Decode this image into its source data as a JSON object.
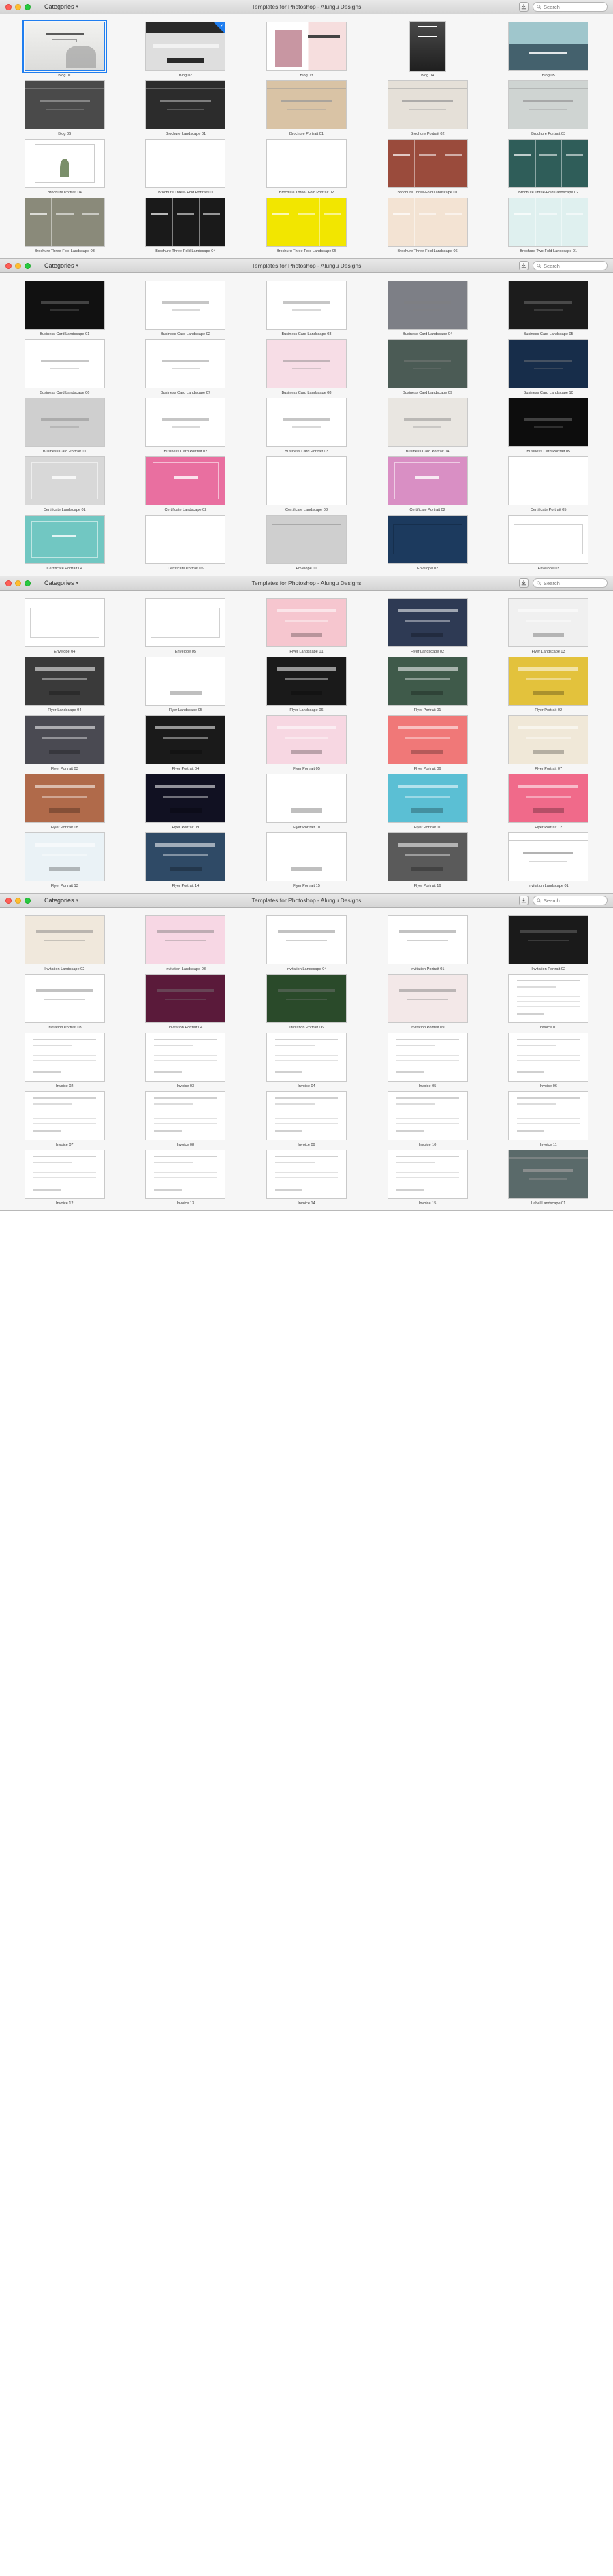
{
  "app": {
    "title": "Templates for Photoshop - Alungu Designs",
    "categories_label": "Categories",
    "search_placeholder": "Search",
    "accent_color": "#1f7ef0",
    "icons": {
      "categories_chevron": "chevron-down-icon",
      "download": "download-icon",
      "search": "search-icon",
      "selected_check": "check-icon"
    }
  },
  "windows": [
    {
      "id": "window-1",
      "rows": [
        [
          {
            "label": "Blog 01",
            "shape": "land",
            "selected": true,
            "bg": "#e8e8e6",
            "style": "blogtitle"
          },
          {
            "label": "Blog 02",
            "shape": "land",
            "badge": true,
            "bg": "#2a2a2a",
            "style": "blogdark"
          },
          {
            "label": "Blog 03",
            "shape": "land",
            "bg": "#f6dede",
            "style": "blogpink"
          },
          {
            "label": "Blog 04",
            "shape": "port",
            "bg": "#3c3c3c",
            "style": "blogbw"
          },
          {
            "label": "Blog 05",
            "shape": "land",
            "bg": "#4a6b78",
            "style": "blogsea"
          }
        ],
        [
          {
            "label": "Blog 06",
            "shape": "land",
            "bg": "#4a4a4a",
            "style": "portraitgray"
          },
          {
            "label": "Brochure Landscape 01",
            "shape": "land",
            "bg": "#2c2c2c",
            "style": "brochuredark"
          },
          {
            "label": "Brochure Portrait 01",
            "shape": "land",
            "bg": "#d9c3a5",
            "style": "craft"
          },
          {
            "label": "Brochure Portrait 02",
            "shape": "land",
            "bg": "#e5e0d8",
            "style": "pizza"
          },
          {
            "label": "Brochure Portrait 03",
            "shape": "land",
            "bg": "#cfd4d2",
            "style": "fog"
          }
        ],
        [
          {
            "label": "Brochure Portrait 04",
            "shape": "land",
            "bg": "#ffffff",
            "style": "garden"
          },
          {
            "label": "Brochure Three- Fold Portrait 01",
            "shape": "land",
            "bg": "#ffffff",
            "style": "tri1"
          },
          {
            "label": "Brochure Three- Fold Portrait 02",
            "shape": "land",
            "bg": "#ffffff",
            "style": "tri2"
          },
          {
            "label": "Brochure Three-Fold Landscape 01",
            "shape": "land",
            "bg": "#9a4b3c",
            "style": "tri3"
          },
          {
            "label": "Brochure Three-Fold Landscape 02",
            "shape": "land",
            "bg": "#2f5d59",
            "style": "tri4"
          }
        ],
        [
          {
            "label": "Brochure Three-Fold Landscape 03",
            "shape": "land",
            "bg": "#8a8a7a",
            "style": "tri5"
          },
          {
            "label": "Brochure Three-Fold Landscape 04",
            "shape": "land",
            "bg": "#1a1a1a",
            "style": "tri6"
          },
          {
            "label": "Brochure Three-Fold Landscape 05",
            "shape": "land",
            "bg": "#f2e600",
            "style": "tri7"
          },
          {
            "label": "Brochure Three-Fold Landscape 06",
            "shape": "land",
            "bg": "#f3e3d3",
            "style": "tri8"
          },
          {
            "label": "Brochure Two-Fold Landscape 01",
            "shape": "land",
            "bg": "#dff0ef",
            "style": "tri9"
          }
        ]
      ]
    },
    {
      "id": "window-2",
      "rows": [
        [
          {
            "label": "Business Card Landscape 01",
            "shape": "land",
            "bg": "#111111",
            "style": "anew"
          },
          {
            "label": "Business Card Landscape 02",
            "shape": "land",
            "bg": "#ffffff",
            "style": "queens"
          },
          {
            "label": "Business Card Landscape 03",
            "shape": "land",
            "bg": "#ffffff",
            "style": "lucy"
          },
          {
            "label": "Business Card Landscape 04",
            "shape": "land",
            "bg": "#7d7f86",
            "style": "bcgray"
          },
          {
            "label": "Business Card Landscape 05",
            "shape": "land",
            "bg": "#1c1c1c",
            "style": "cuisine"
          }
        ],
        [
          {
            "label": "Business Card Landscape 06",
            "shape": "land",
            "bg": "#ffffff",
            "style": "bcplain"
          },
          {
            "label": "Business Card Landscape 07",
            "shape": "land",
            "bg": "#ffffff",
            "style": "bcgeo"
          },
          {
            "label": "Business Card Landscape 08",
            "shape": "land",
            "bg": "#f7dde6",
            "style": "wedding"
          },
          {
            "label": "Business Card Landscape 09",
            "shape": "land",
            "bg": "#4b5b55",
            "style": "bcdarkgreen"
          },
          {
            "label": "Business Card Landscape 10",
            "shape": "land",
            "bg": "#172d4a",
            "style": "bcnavy"
          }
        ],
        [
          {
            "label": "Business Card Portrait 01",
            "shape": "land",
            "bg": "#cfcfcf",
            "style": "bcp1"
          },
          {
            "label": "Business Card Portrait 02",
            "shape": "land",
            "bg": "#ffffff",
            "style": "bcp2"
          },
          {
            "label": "Business Card Portrait 03",
            "shape": "land",
            "bg": "#ffffff",
            "style": "bcp3"
          },
          {
            "label": "Business Card Portrait 04",
            "shape": "land",
            "bg": "#e9e6e1",
            "style": "bcp4"
          },
          {
            "label": "Business Card Portrait 05",
            "shape": "land",
            "bg": "#0d0d0d",
            "style": "bcp5"
          }
        ],
        [
          {
            "label": "Certificate Landscape 01",
            "shape": "land",
            "bg": "#d8d8d8",
            "style": "cert1"
          },
          {
            "label": "Certificate Landscape 02",
            "shape": "land",
            "bg": "#e96fa0",
            "style": "cert2"
          },
          {
            "label": "Certificate Landscape 03",
            "shape": "land",
            "bg": "#ffffff",
            "style": "cert3"
          },
          {
            "label": "Certificate Portrait 02",
            "shape": "land",
            "bg": "#d98fc4",
            "style": "cert4"
          },
          {
            "label": "Certificate Portrait 05",
            "shape": "land",
            "bg": "#ffffff",
            "style": "cert5"
          }
        ],
        [
          {
            "label": "Certificate Portrait 04",
            "shape": "land",
            "bg": "#71c7c2",
            "style": "cert6"
          },
          {
            "label": "Certificate Portrait 05",
            "shape": "land",
            "bg": "#ffffff",
            "style": "cert7"
          },
          {
            "label": "Envelope 01",
            "shape": "land",
            "bg": "#cfcfcf",
            "style": "env1"
          },
          {
            "label": "Envelope 02",
            "shape": "land",
            "bg": "#1c3a5e",
            "style": "env2"
          },
          {
            "label": "Envelope 03",
            "shape": "land",
            "bg": "#ffffff",
            "style": "env3"
          }
        ]
      ]
    },
    {
      "id": "window-3",
      "rows": [
        [
          {
            "label": "Envelope 04",
            "shape": "land",
            "bg": "#ffffff",
            "style": "env4"
          },
          {
            "label": "Envelope 05",
            "shape": "land",
            "bg": "#ffffff",
            "style": "env5"
          },
          {
            "label": "Flyer Landscape 01",
            "shape": "land",
            "bg": "#f6c6cf",
            "style": "fl1"
          },
          {
            "label": "Flyer Landscape 02",
            "shape": "land",
            "bg": "#2e3a54",
            "style": "fl2"
          },
          {
            "label": "Flyer Landscape 03",
            "shape": "land",
            "bg": "#f0f0f0",
            "style": "fl3"
          }
        ],
        [
          {
            "label": "Flyer Landscape 04",
            "shape": "land",
            "bg": "#3a3a3a",
            "style": "fl4"
          },
          {
            "label": "Flyer Landscape 05",
            "shape": "land",
            "bg": "#ffffff",
            "style": "fl5"
          },
          {
            "label": "Flyer Landscape 06",
            "shape": "land",
            "bg": "#1a1a1a",
            "style": "fl6"
          },
          {
            "label": "Flyer Portrait 01",
            "shape": "land",
            "bg": "#3f5a4a",
            "style": "fp1"
          },
          {
            "label": "Flyer Portrait 02",
            "shape": "land",
            "bg": "#e3c23c",
            "style": "fp2"
          }
        ],
        [
          {
            "label": "Flyer Portrait 03",
            "shape": "land",
            "bg": "#4a4a52",
            "style": "fp3"
          },
          {
            "label": "Flyer Portrait 04",
            "shape": "land",
            "bg": "#1a1a1a",
            "style": "fp4"
          },
          {
            "label": "Flyer Portrait 05",
            "shape": "land",
            "bg": "#f7d7e2",
            "style": "fp5"
          },
          {
            "label": "Flyer Portrait 06",
            "shape": "land",
            "bg": "#f07878",
            "style": "fp6"
          },
          {
            "label": "Flyer Portrait 07",
            "shape": "land",
            "bg": "#f0e8d8",
            "style": "fp7"
          }
        ],
        [
          {
            "label": "Flyer Portrait 08",
            "shape": "land",
            "bg": "#b06a4a",
            "style": "fp8"
          },
          {
            "label": "Flyer Portrait 09",
            "shape": "land",
            "bg": "#111122",
            "style": "fp9"
          },
          {
            "label": "Flyer Portrait 10",
            "shape": "land",
            "bg": "#ffffff",
            "style": "fp10"
          },
          {
            "label": "Flyer Portrait 11",
            "shape": "land",
            "bg": "#5bbfd4",
            "style": "fp11"
          },
          {
            "label": "Flyer Portrait 12",
            "shape": "land",
            "bg": "#f06a8a",
            "style": "fp12"
          }
        ],
        [
          {
            "label": "Flyer Portrait 13",
            "shape": "land",
            "bg": "#eaf2f6",
            "style": "fp13"
          },
          {
            "label": "Flyer Portrait 14",
            "shape": "land",
            "bg": "#2f4a66",
            "style": "fp14"
          },
          {
            "label": "Flyer Portrait 15",
            "shape": "land",
            "bg": "#ffffff",
            "style": "fp15"
          },
          {
            "label": "Flyer Portrait 16",
            "shape": "land",
            "bg": "#5a5a5a",
            "style": "fp16"
          },
          {
            "label": "Invitation Landscape 01",
            "shape": "land",
            "bg": "#ffffff",
            "style": "inv1"
          }
        ]
      ]
    },
    {
      "id": "window-4",
      "rows": [
        [
          {
            "label": "Invitation Landscape 02",
            "shape": "land",
            "bg": "#f0e8dc",
            "style": "il2"
          },
          {
            "label": "Invitation Landscape 03",
            "shape": "land",
            "bg": "#f7d7e4",
            "style": "il3"
          },
          {
            "label": "Invitation Landscape 04",
            "shape": "land",
            "bg": "#ffffff",
            "style": "il4"
          },
          {
            "label": "Invitation Portrait 01",
            "shape": "land",
            "bg": "#ffffff",
            "style": "ip1"
          },
          {
            "label": "Invitation Portrait 02",
            "shape": "land",
            "bg": "#1a1a1a",
            "style": "ip2"
          }
        ],
        [
          {
            "label": "Invitation Portrait 03",
            "shape": "land",
            "bg": "#ffffff",
            "style": "ip3"
          },
          {
            "label": "Invitation Portrait 04",
            "shape": "land",
            "bg": "#5a1a3a",
            "style": "ip4"
          },
          {
            "label": "Invitation Portrait 06",
            "shape": "land",
            "bg": "#2a4a2a",
            "style": "ip6"
          },
          {
            "label": "Invitation Portrait 09",
            "shape": "land",
            "bg": "#f3e8e8",
            "style": "ip9"
          },
          {
            "label": "Invoice 01",
            "shape": "land",
            "bg": "#ffffff",
            "style": "in1"
          }
        ],
        [
          {
            "label": "Invoice 02",
            "shape": "land",
            "bg": "#ffffff",
            "style": "in2"
          },
          {
            "label": "Invoice 03",
            "shape": "land",
            "bg": "#eaf4f8",
            "style": "in3"
          },
          {
            "label": "Invoice 04",
            "shape": "land",
            "bg": "#ffffff",
            "style": "in4"
          },
          {
            "label": "Invoice 05",
            "shape": "land",
            "bg": "#ffffff",
            "style": "in5"
          },
          {
            "label": "Invoice 06",
            "shape": "land",
            "bg": "#ffffff",
            "style": "in6"
          }
        ],
        [
          {
            "label": "Invoice 07",
            "shape": "land",
            "bg": "#d4a96a",
            "style": "in7"
          },
          {
            "label": "Invoice 08",
            "shape": "land",
            "bg": "#ffffff",
            "style": "in8"
          },
          {
            "label": "Invoice 09",
            "shape": "land",
            "bg": "#ffffff",
            "style": "in9"
          },
          {
            "label": "Invoice 10",
            "shape": "land",
            "bg": "#ffffff",
            "style": "in10"
          },
          {
            "label": "Invoice 11",
            "shape": "land",
            "bg": "#ffffff",
            "style": "in11"
          }
        ],
        [
          {
            "label": "Invoice 12",
            "shape": "land",
            "bg": "#ffffff",
            "style": "in12"
          },
          {
            "label": "Invoice 13",
            "shape": "land",
            "bg": "#eaf4f8",
            "style": "in13"
          },
          {
            "label": "Invoice 14",
            "shape": "land",
            "bg": "#ffffff",
            "style": "in14"
          },
          {
            "label": "Invoice 15",
            "shape": "land",
            "bg": "#ffffff",
            "style": "in15"
          },
          {
            "label": "Label Landscape 01",
            "shape": "land",
            "bg": "#5a6a6a",
            "style": "lb1"
          }
        ]
      ]
    }
  ]
}
